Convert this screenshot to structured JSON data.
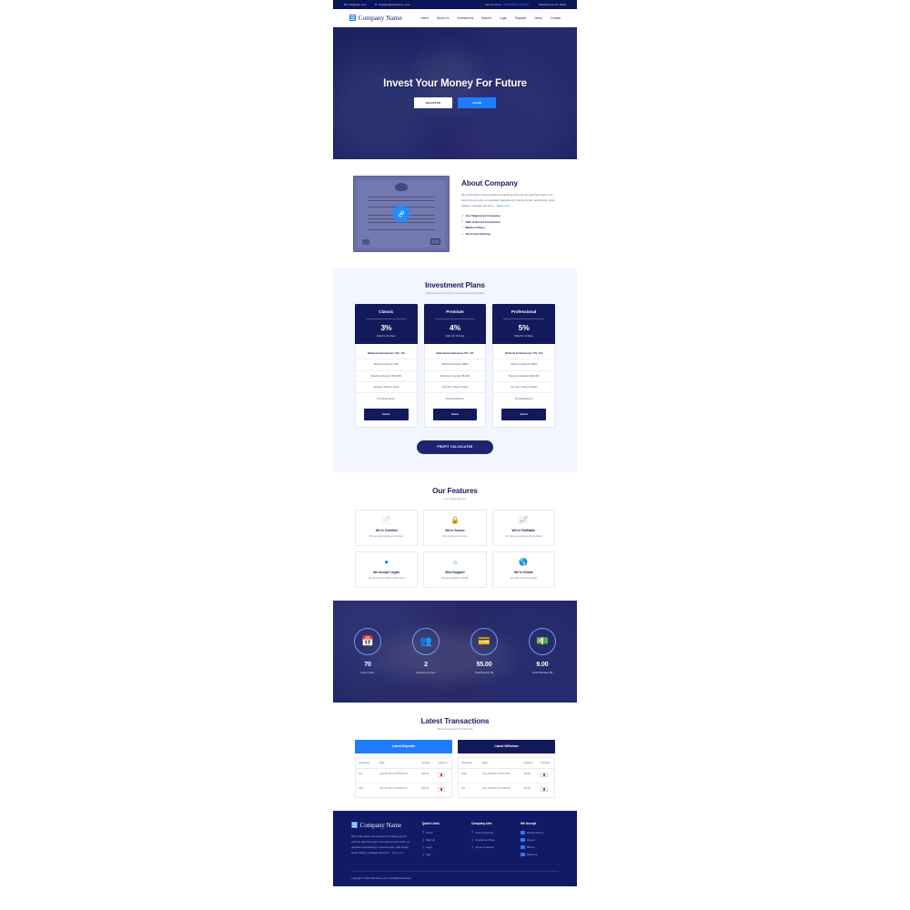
{
  "topbar": {
    "email_label": "info@site.com",
    "support_label": "Support@sitename.com",
    "server_time_label": "Server Time:",
    "server_time_value": "02/08/2019 9:02:22",
    "started_label": "Started Feb 15, 2019"
  },
  "header": {
    "brand": "Company Name",
    "nav": [
      {
        "label": "Home"
      },
      {
        "label": "About Us"
      },
      {
        "label": "Investments"
      },
      {
        "label": "Banner"
      },
      {
        "label": "Login"
      },
      {
        "label": "Register"
      },
      {
        "label": "News"
      },
      {
        "label": "Contact"
      }
    ]
  },
  "hero": {
    "title": "Invest Your Money For Future",
    "register_label": "REGISTER",
    "login_label": "LOGIN"
  },
  "about": {
    "heading": "About Company",
    "paragraph": "We at Site Name has experienced steady growth over the past few years in an autonomous mode, an operation specializing in various funds, gold bonds, stock trading, mortgage and forex...",
    "read_more": "Read more",
    "bullets": [
      {
        "label": "Gov Registered Company"
      },
      {
        "label": "Safe & Secure Investment"
      },
      {
        "label": "Midterm Plans"
      },
      {
        "label": "Persistent Earning"
      }
    ],
    "play_icon": "link-icon"
  },
  "plans": {
    "heading": "Investment Plans",
    "subheading": "Following are our long term & persistent earning plans",
    "calculator_label": "PROFIT CALCULATER",
    "items": [
      {
        "name": "Classic",
        "percent": "3%",
        "duration": "Daily For 10 Days",
        "features": [
          "Referral Commission: 5% -1%",
          "Minimum Deposit: $10",
          "Maximum Deposit: $10,000",
          "Accrual 7 Days A Week",
          "Principal Return"
        ],
        "button_label": "Invest"
      },
      {
        "name": "Premium",
        "percent": "4%",
        "duration": "Daily For 10 Days",
        "features": [
          "Referral Commission: 5% -1%",
          "Minimum Deposit: $501",
          "Maximum Deposit: $5,000",
          "Accrual 7 Days A Week",
          "Principal Return"
        ],
        "button_label": "Invest"
      },
      {
        "name": "Professional",
        "percent": "5%",
        "duration": "Daily For 10 Days",
        "features": [
          "Referral Commission: 5% -1%",
          "Minimum Deposit: $501",
          "Maximum Deposit: $10,000",
          "Accrual 7 Days A Week",
          "Principal Return"
        ],
        "button_label": "Invest"
      }
    ]
  },
  "features": {
    "heading": "Our Features",
    "subheading": "our unique features",
    "items": [
      {
        "icon": "certificate-icon",
        "glyph": "❐",
        "title": "We're Certified",
        "desc": "We are govt registered company"
      },
      {
        "icon": "lock-icon",
        "glyph": "ὑ2",
        "title": "We're Secure",
        "desc": "Our plateform is secure"
      },
      {
        "icon": "chart-icon",
        "glyph": "Ὄ8",
        "title": "We're Profitable",
        "desc": "Our plans are persistently profitable"
      },
      {
        "icon": "bitcoin-icon",
        "glyph": "Ƀ",
        "title": "We Accept Crypto",
        "desc": "We accept all certified crypto coins"
      },
      {
        "icon": "headset-icon",
        "glyph": "Ἲ7",
        "title": "Best Support",
        "desc": "We are available 24/7/365"
      },
      {
        "icon": "globe-icon",
        "glyph": "ἱ0",
        "title": "We're Global",
        "desc": "We offer services globally"
      }
    ]
  },
  "stats": [
    {
      "icon": "calendar-icon",
      "glyph": "Ὄ5",
      "value": "70",
      "label": "Days Online"
    },
    {
      "icon": "users-icon",
      "glyph": "὆5",
      "value": "2",
      "label": "Registered Users"
    },
    {
      "icon": "wallet-icon",
      "glyph": "Ὃ3",
      "value": "55.00",
      "label": "Total Deposit ($)"
    },
    {
      "icon": "money-icon",
      "glyph": "Ὃ5",
      "value": "9.00",
      "label": "Total Withdraw ($)"
    }
  ],
  "transactions": {
    "heading": "Latest Transactions",
    "subheading": "Recent Investment & Profit Stats",
    "tab_deposits": "Latest Deposits",
    "tab_withdraw": "Latest Withdraw",
    "columns": [
      "Username",
      "Date",
      "Amount",
      "Currency"
    ],
    "deposits": [
      {
        "username": "test",
        "date": "Feb-15-2019 12:58:50 PM",
        "amount": "$25.00",
        "currency": "currency-flag"
      },
      {
        "username": "edits",
        "date": "Feb-15-2019 12:48:52 PM",
        "amount": "$30.00",
        "currency": "currency-flag"
      }
    ],
    "withdraw": [
      {
        "username": "edits",
        "date": "Feb-15-2019 12:58:01 PM",
        "amount": "$5.00",
        "currency": "currency-flag"
      },
      {
        "username": "test",
        "date": "Feb-15-2019 12:57:58 PM",
        "amount": "$4.00",
        "currency": "currency-flag"
      }
    ]
  },
  "footer": {
    "brand": "Company Name",
    "about": "We at Site Name has experienced steady growth over the past few years in an autonomous mode, an operation specializing in various funds, gold bonds, stock trading, mortgage and forex...",
    "read_more": "Read more",
    "quick_links_heading": "Quick Links",
    "quick_links": [
      {
        "label": "Home"
      },
      {
        "label": "Sign Up"
      },
      {
        "label": "Login"
      },
      {
        "label": "Faq"
      }
    ],
    "company_info_heading": "Company Info",
    "company_info": [
      {
        "label": "About Company"
      },
      {
        "label": "Investment Plans"
      },
      {
        "label": "Terms of Service"
      }
    ],
    "we_accept_heading": "We Accept",
    "we_accept": [
      {
        "label": "Perfect Money"
      },
      {
        "label": "Payeer"
      },
      {
        "label": "BitCoin"
      },
      {
        "label": "Ethereum"
      }
    ],
    "copyright": "Copyright © 2019 Site-Name.com, All Rights Reserved."
  },
  "colors": {
    "navy": "#131a5c",
    "blue": "#1f7cff",
    "light_bg": "#f3f6fe"
  }
}
